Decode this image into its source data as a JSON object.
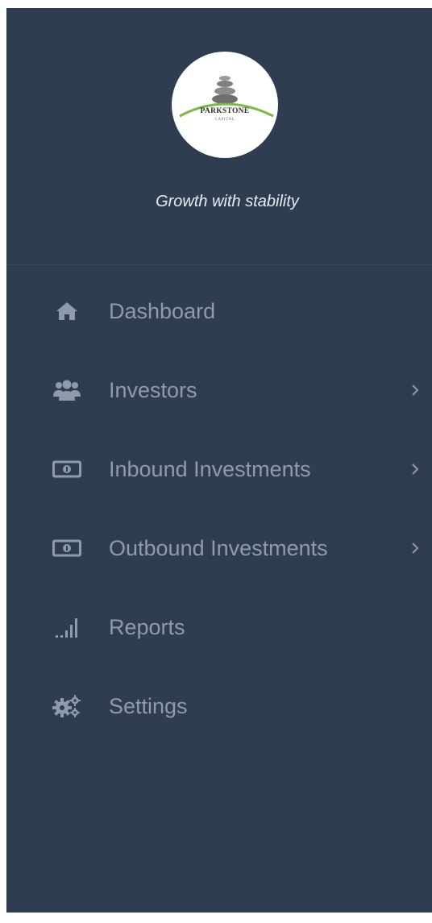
{
  "brand": {
    "logo_name": "PARKSTONE",
    "logo_sub": "CAPITAL",
    "tagline": "Growth with stability"
  },
  "menu": [
    {
      "label": "Dashboard",
      "icon": "home-icon",
      "has_submenu": false
    },
    {
      "label": "Investors",
      "icon": "users-icon",
      "has_submenu": true
    },
    {
      "label": "Inbound Investments",
      "icon": "money-icon",
      "has_submenu": true
    },
    {
      "label": "Outbound Investments",
      "icon": "money-icon",
      "has_submenu": true
    },
    {
      "label": "Reports",
      "icon": "signal-icon",
      "has_submenu": false
    },
    {
      "label": "Settings",
      "icon": "gears-icon",
      "has_submenu": false
    }
  ],
  "colors": {
    "sidebar_bg": "#2e3d4f",
    "text_muted": "#8f9bab",
    "tagline": "#e6ebf0",
    "logo_arc": "#7ab648"
  }
}
